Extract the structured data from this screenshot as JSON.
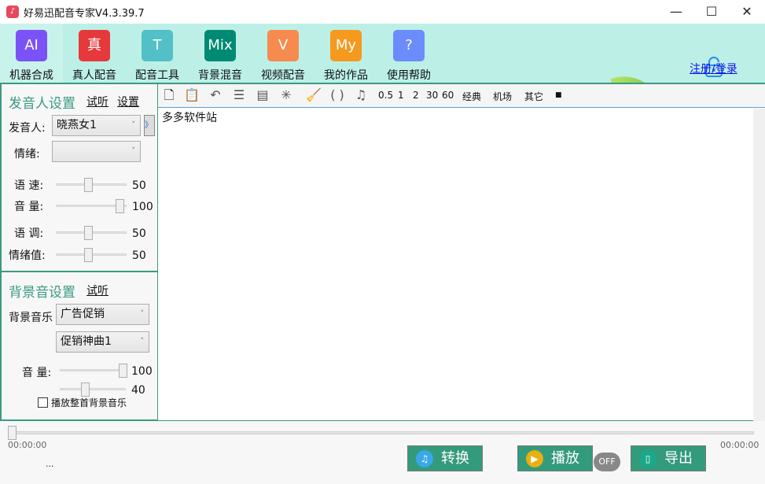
{
  "window": {
    "title": "好易迅配音专家V4.3.39.7",
    "minimize": "—",
    "maximize": "☐",
    "close": "✕"
  },
  "nav": [
    {
      "icon": "AI",
      "label": "机器合成",
      "color": "#7b52f5"
    },
    {
      "icon": "真",
      "label": "真人配音",
      "color": "#e5393c"
    },
    {
      "icon": "T",
      "label": "配音工具",
      "color": "#52c0c6"
    },
    {
      "icon": "Mix",
      "label": "背景混音",
      "color": "#008a74"
    },
    {
      "icon": "V",
      "label": "视频配音",
      "color": "#f78a4f"
    },
    {
      "icon": "My",
      "label": "我的作品",
      "color": "#f59a1e"
    },
    {
      "icon": "?",
      "label": "使用帮助",
      "color": "#6b8cfb"
    }
  ],
  "login": "注册/登录",
  "voice": {
    "title": "发音人设置",
    "preview": "试听",
    "settings": "设置",
    "speaker_label": "发音人:",
    "speaker": "晓燕女1",
    "expand": "》",
    "emotion_label": "情绪:",
    "emotion": "",
    "sliders": [
      {
        "label": "语 速:",
        "value": 50,
        "pct": 50
      },
      {
        "label": "音 量:",
        "value": 100,
        "pct": 100
      },
      {
        "label": "语 调:",
        "value": 50,
        "pct": 50
      },
      {
        "label": "情绪值:",
        "value": 50,
        "pct": 50
      }
    ]
  },
  "bg": {
    "title": "背景音设置",
    "preview": "试听",
    "music_label": "背景音乐",
    "category": "广告促销",
    "track": "促销神曲1",
    "volume_label": "音 量:",
    "volume": 100,
    "volume_pct": 100,
    "second": 40,
    "second_pct": 40,
    "loop_label": "播放整首背景音乐",
    "loop": false
  },
  "toolbar": {
    "pauses": [
      "0.5",
      "1",
      "2",
      "30",
      "60"
    ],
    "effects": [
      "经典",
      "机场",
      "其它"
    ],
    "stop": "■",
    "parens": "( )"
  },
  "editor": {
    "text": "多多软件站"
  },
  "player": {
    "start": "00:00:00",
    "end": "00:00:00",
    "progress": 0,
    "convert": "转换",
    "play": "播放",
    "toggle": "OFF",
    "export": "导出",
    "status": "..."
  }
}
